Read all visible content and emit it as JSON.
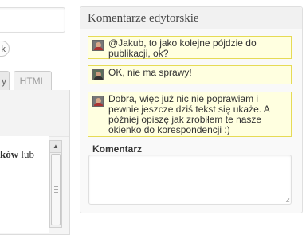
{
  "editor": {
    "pill_label": "k",
    "tab_visual": "y",
    "tab_html": "HTML",
    "content_bold": "ków",
    "content_rest": " lub",
    "scroll_up": "▲"
  },
  "comments_panel": {
    "title": "Komentarze edytorskie",
    "comments": [
      {
        "text": "@Jakub, to jako kolejne pójdzie do publikacji, ok?"
      },
      {
        "text": "OK, nie ma sprawy!"
      },
      {
        "text": "Dobra, więc już nic nie poprawiam i pewnie jeszcze dziś tekst się ukaże. A później opiszę jak zrobiłem te nasze okienko do korespondencji :)"
      }
    ],
    "form": {
      "label": "Komentarz",
      "value": ""
    }
  }
}
